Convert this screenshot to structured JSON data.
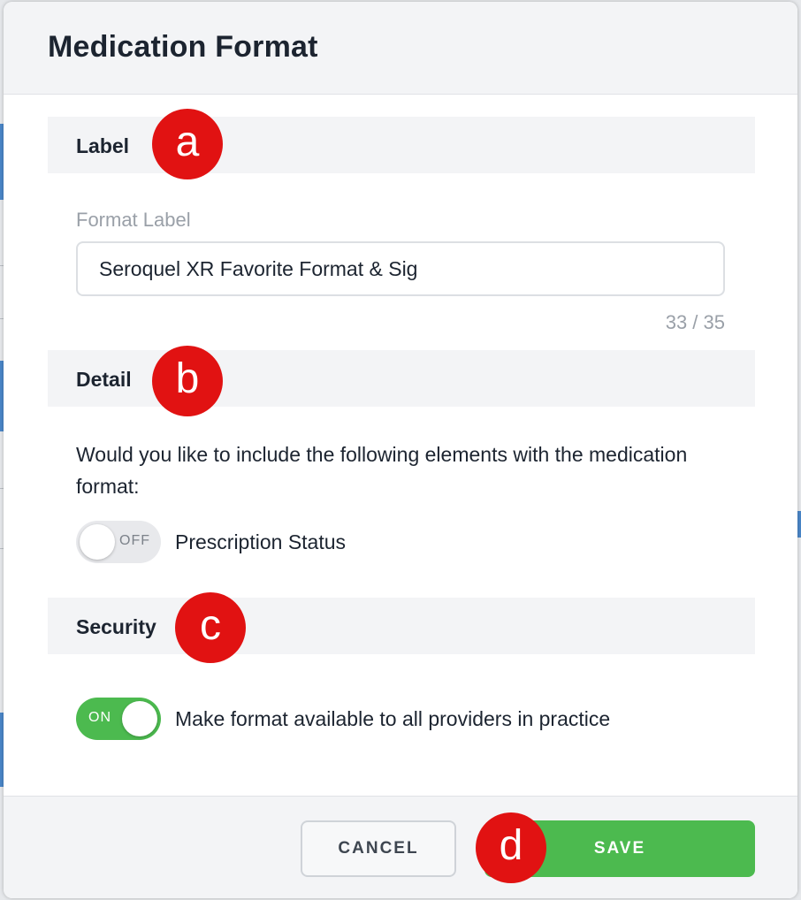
{
  "dialog": {
    "title": "Medication Format"
  },
  "sections": {
    "label": {
      "title": "Label",
      "marker": "a",
      "field_label": "Format Label",
      "input_value": "Seroquel XR Favorite Format & Sig",
      "counter": "33 / 35"
    },
    "detail": {
      "title": "Detail",
      "marker": "b",
      "prompt": "Would you like to include the following elements with the medication format:",
      "toggle": {
        "state_text": "OFF",
        "checked": false,
        "caption": "Prescription Status"
      }
    },
    "security": {
      "title": "Security",
      "marker": "c",
      "toggle": {
        "state_text": "ON",
        "checked": true,
        "caption": "Make format available to all providers in practice"
      }
    }
  },
  "footer": {
    "cancel_label": "CANCEL",
    "save_label": "SAVE",
    "marker": "d"
  },
  "colors": {
    "accent_green": "#4cba4f",
    "marker_red": "#e11212",
    "header_gray": "#f3f4f6",
    "text_dark": "#1c2430"
  },
  "icons": {
    "marker_shape": "red-circle-letter-badge"
  }
}
